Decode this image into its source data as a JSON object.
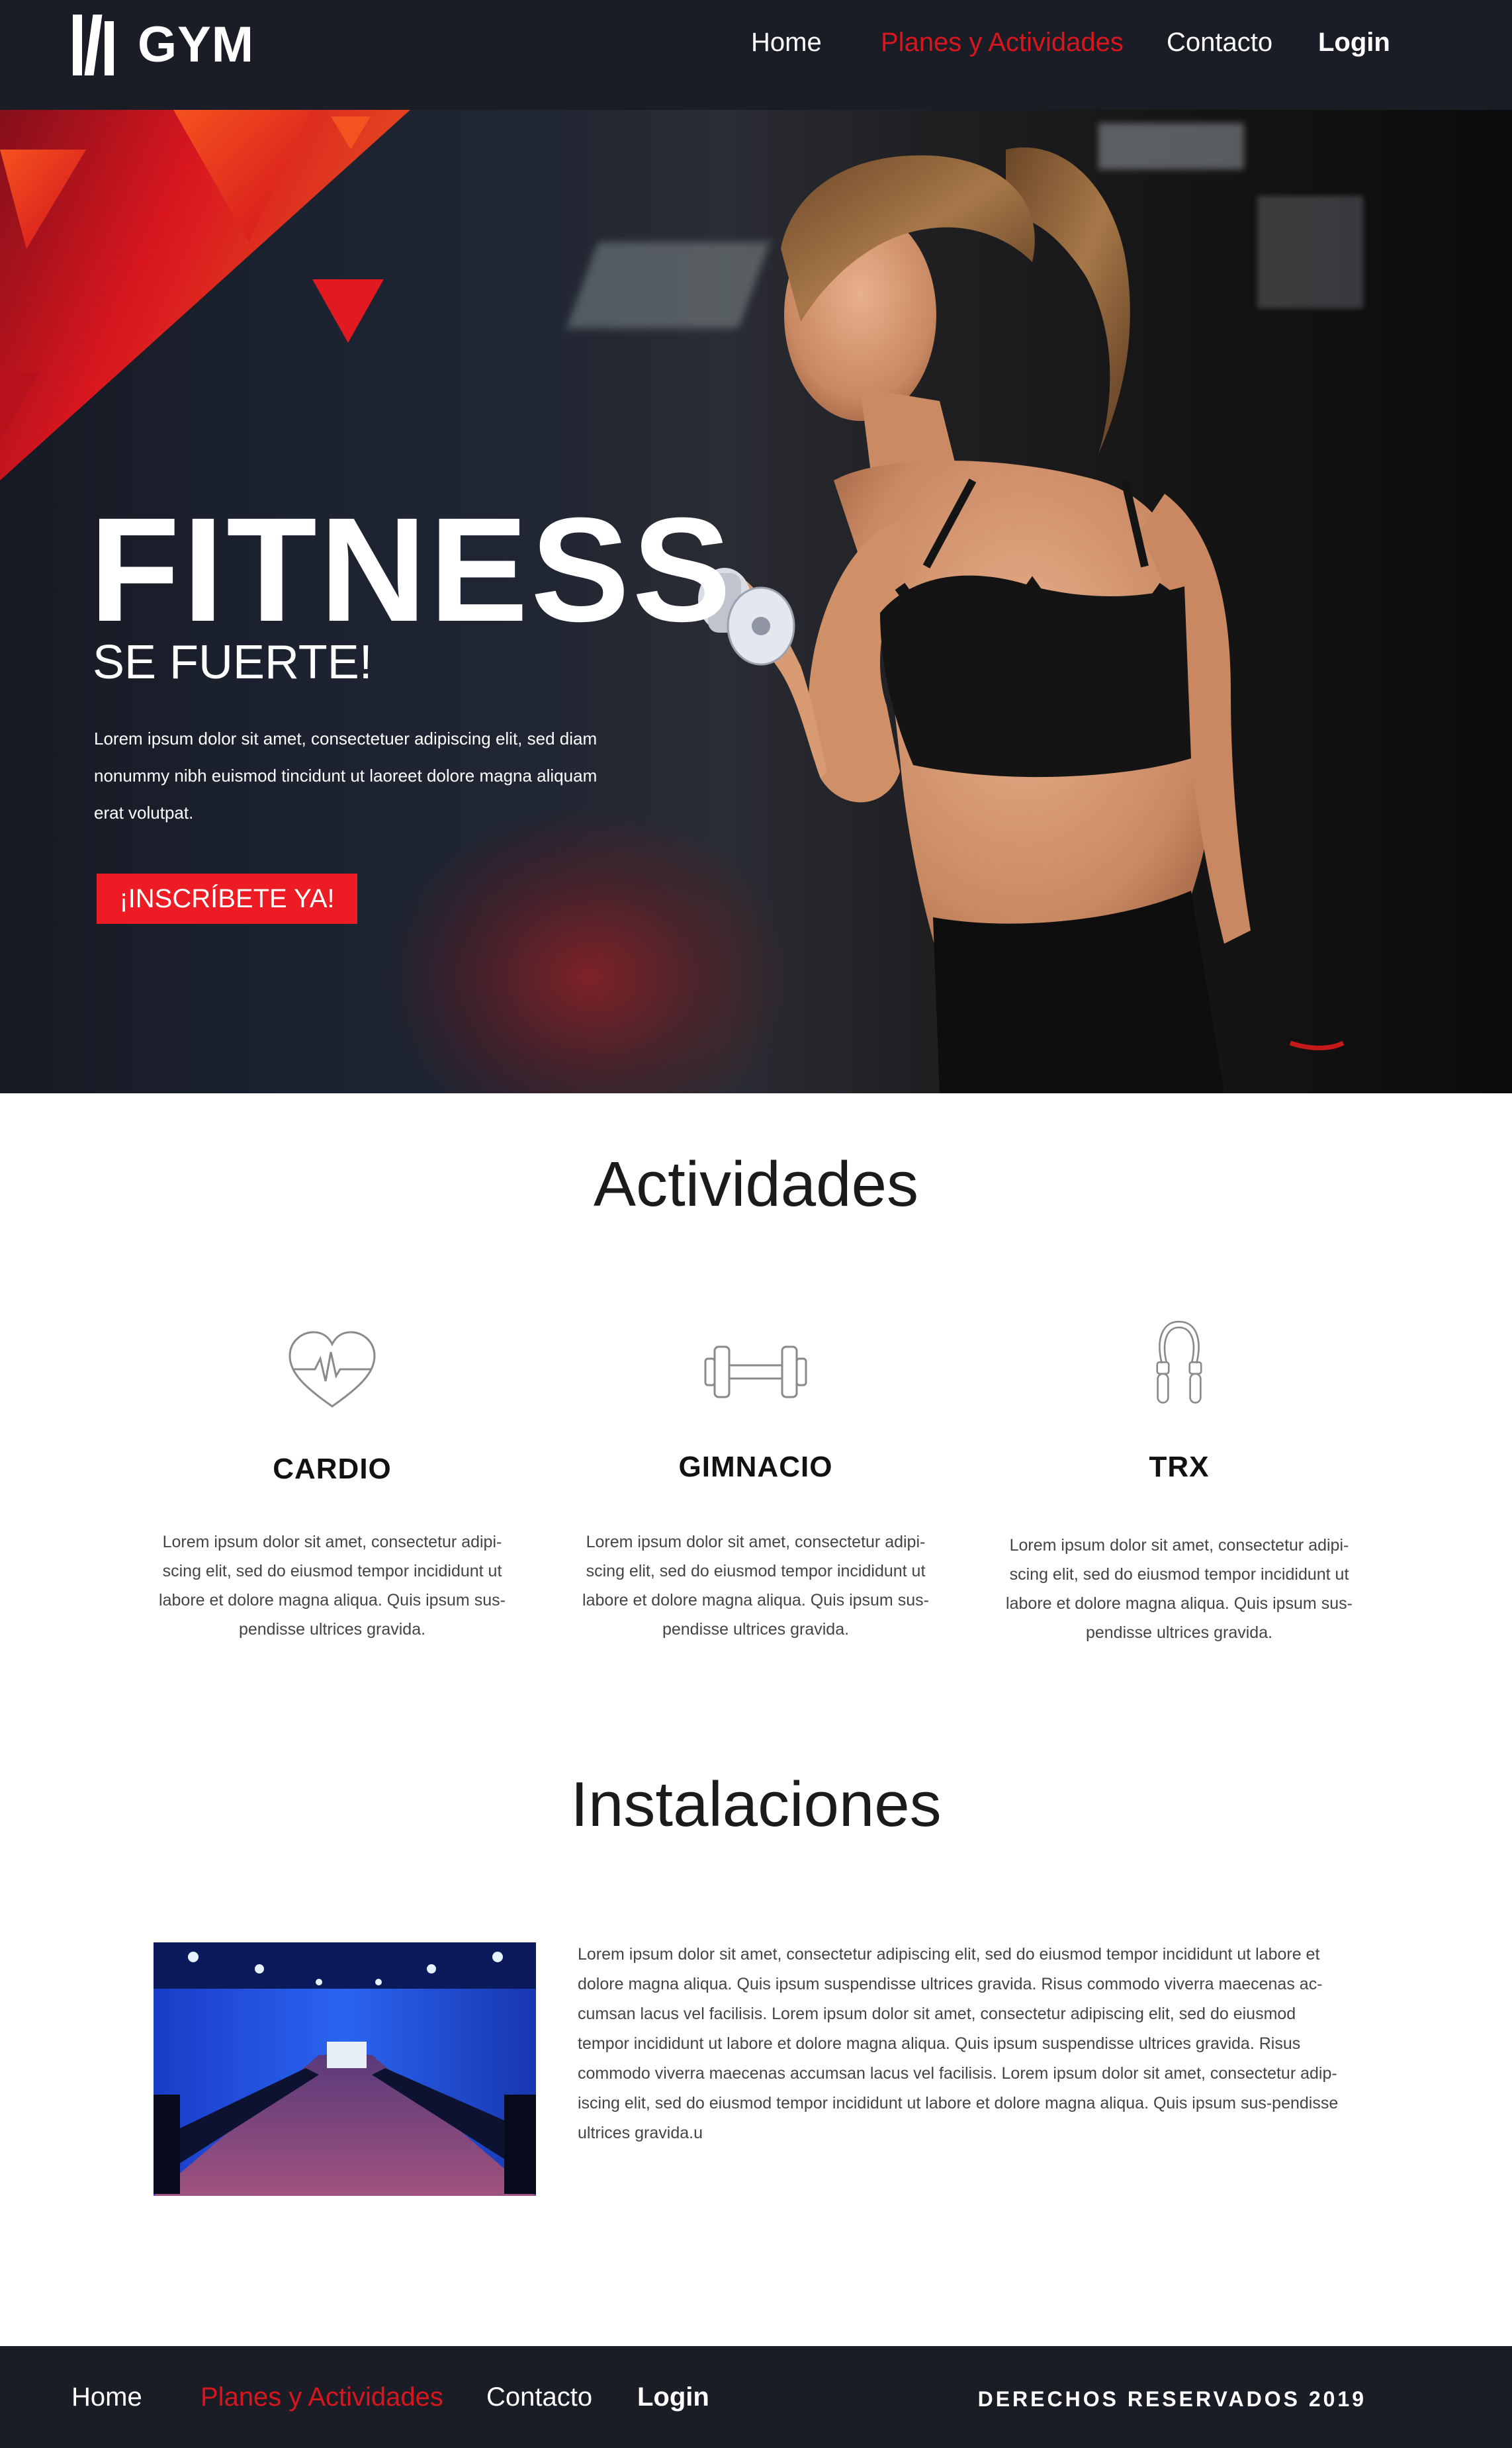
{
  "header": {
    "logo_text": "GYM",
    "nav": [
      {
        "label": "Home",
        "active": false
      },
      {
        "label": "Planes y Actividades",
        "active": true
      },
      {
        "label": "Contacto",
        "active": false
      },
      {
        "label": "Login",
        "active": false
      }
    ]
  },
  "hero": {
    "title": "FITNESS",
    "subtitle": "SE FUERTE!",
    "text": "Lorem ipsum dolor sit amet, consectetuer adipiscing elit, sed diam nonummy nibh euismod tincidunt ut laoreet dolore magna aliquam erat volutpat.",
    "cta": "¡INSCRÍBETE YA!"
  },
  "activities": {
    "title": "Actividades",
    "items": [
      {
        "icon": "heart-pulse-icon",
        "name": "CARDIO",
        "desc": "Lorem ipsum dolor sit amet, consectetur adipi-scing elit, sed do eiusmod tempor incididunt ut labore et dolore magna aliqua. Quis ipsum sus-pendisse ultrices gravida."
      },
      {
        "icon": "dumbbell-icon",
        "name": "GIMNACIO",
        "desc": "Lorem ipsum dolor sit amet, consectetur adipi-scing elit, sed do eiusmod tempor incididunt ut labore et dolore magna aliqua. Quis ipsum sus-pendisse ultrices gravida."
      },
      {
        "icon": "jump-rope-icon",
        "name": "TRX",
        "desc": "Lorem ipsum dolor sit amet, consectetur adipi-scing elit, sed do eiusmod tempor incididunt ut labore et dolore magna aliqua. Quis ipsum sus-pendisse ultrices gravida."
      }
    ]
  },
  "facilities": {
    "title": "Instalaciones",
    "text": "Lorem ipsum dolor sit amet, consectetur adipiscing elit, sed do eiusmod tempor incididunt ut labore et dolore magna aliqua. Quis ipsum suspendisse ultrices gravida. Risus commodo viverra maecenas ac-cumsan lacus vel facilisis. Lorem ipsum dolor sit amet, consectetur adipiscing elit, sed do eiusmod tempor incididunt ut labore et dolore magna aliqua. Quis ipsum suspendisse ultrices gravida. Risus commodo viverra maecenas accumsan lacus vel facilisis. Lorem ipsum dolor sit amet, consectetur adip-iscing elit, sed do eiusmod tempor incididunt ut labore et dolore magna aliqua. Quis ipsum sus-pendisse ultrices gravida.u"
  },
  "footer": {
    "nav": [
      {
        "label": "Home",
        "active": false
      },
      {
        "label": "Planes y Actividades",
        "active": true
      },
      {
        "label": "Contacto",
        "active": false
      },
      {
        "label": "Login",
        "active": false
      }
    ],
    "copyright": "DERECHOS RESERVADOS 2019"
  },
  "colors": {
    "accent": "#ed1c24",
    "active_link": "#d7161e",
    "header_bg": "#1a1d25"
  }
}
